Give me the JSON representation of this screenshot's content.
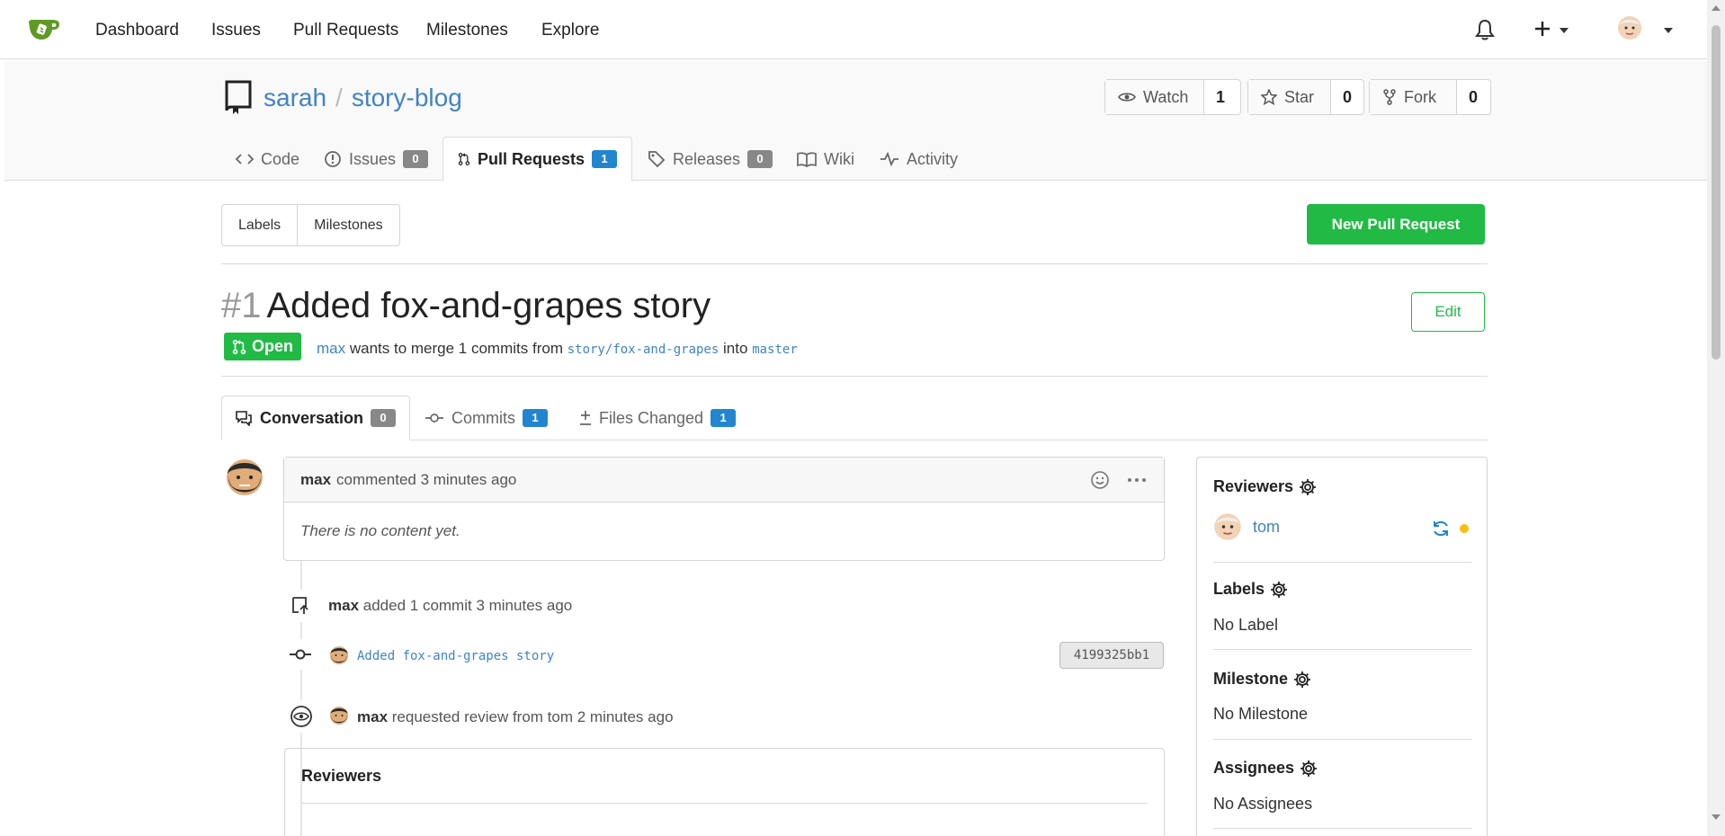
{
  "nav": {
    "items": [
      "Dashboard",
      "Issues",
      "Pull Requests",
      "Milestones",
      "Explore"
    ],
    "icons": [
      "bell-icon",
      "plus-icon",
      "avatar"
    ]
  },
  "repo": {
    "owner": "sarah",
    "name": "story-blog",
    "watch_label": "Watch",
    "watch_count": "1",
    "star_label": "Star",
    "star_count": "0",
    "fork_label": "Fork",
    "fork_count": "0"
  },
  "repo_tabs": {
    "code": "Code",
    "issues": "Issues",
    "issues_count": "0",
    "pulls": "Pull Requests",
    "pulls_count": "1",
    "releases": "Releases",
    "releases_count": "0",
    "wiki": "Wiki",
    "activity": "Activity"
  },
  "filters": {
    "labels": "Labels",
    "milestones": "Milestones"
  },
  "new_pr_label": "New Pull Request",
  "pr": {
    "number": "#1",
    "title": "Added fox-and-grapes story",
    "edit_label": "Edit",
    "state": "Open",
    "author": "max",
    "meta_mid": "wants to merge 1 commits from",
    "head_branch": "story/fox-and-grapes",
    "meta_into": "into",
    "base_branch": "master"
  },
  "pr_tabs": {
    "conversation": "Conversation",
    "conversation_count": "0",
    "commits": "Commits",
    "commits_count": "1",
    "files": "Files Changed",
    "files_count": "1"
  },
  "comment": {
    "author": "max",
    "action": "commented 3 minutes ago",
    "body": "There is no content yet."
  },
  "timeline": {
    "push_user": "max",
    "push_text": "added 1 commit 3 minutes ago",
    "commit_message": "Added fox-and-grapes story",
    "commit_sha": "4199325bb1",
    "review_user": "max",
    "review_text": "requested review from tom 2 minutes ago",
    "reviewers_title": "Reviewers"
  },
  "sidebar": {
    "reviewers_title": "Reviewers",
    "reviewer": "tom",
    "reviewer_status_color": "#fbbd08",
    "labels_title": "Labels",
    "labels_value": "No Label",
    "milestone_title": "Milestone",
    "milestone_value": "No Milestone",
    "assignees_title": "Assignees",
    "assignees_value": "No Assignees"
  },
  "colors": {
    "accent": "#4183c4",
    "success": "#21ba45",
    "badge_blue": "#2185d0",
    "logo": "#609926"
  }
}
